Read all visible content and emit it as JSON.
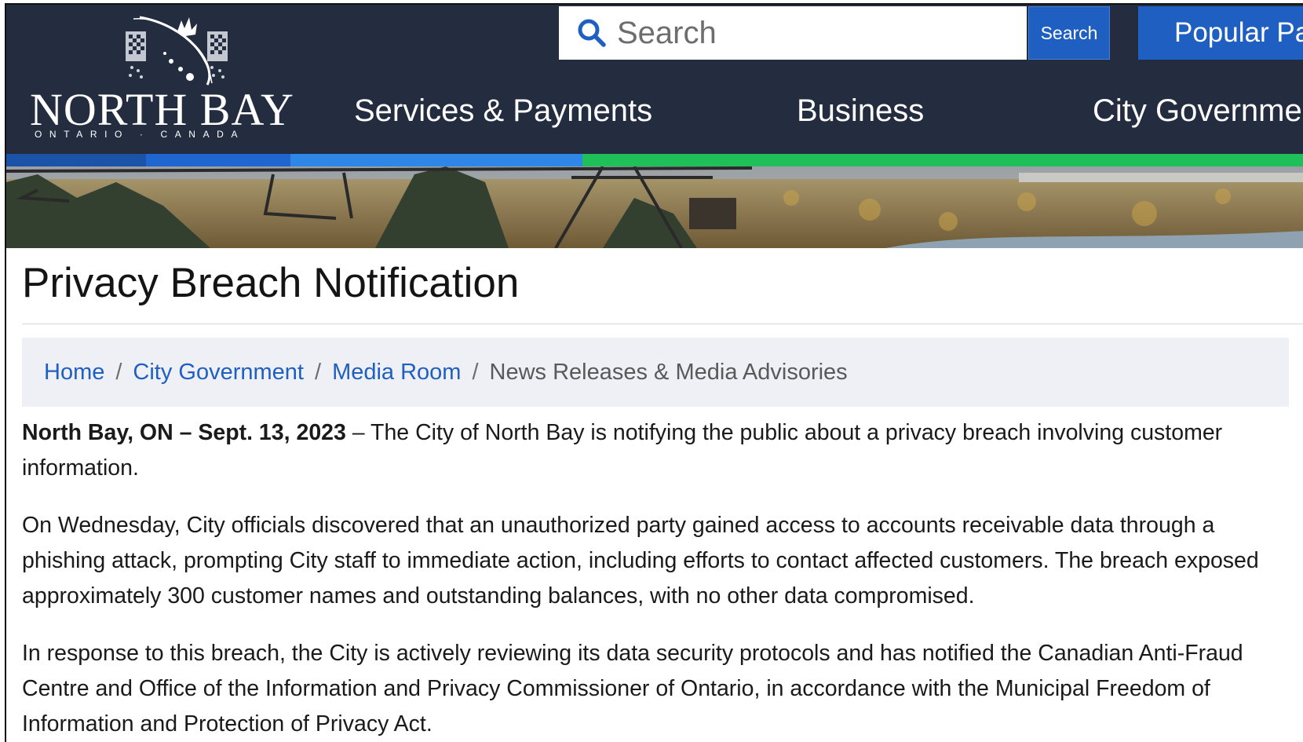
{
  "header": {
    "logo": {
      "wordmark": "NORTH BAY",
      "tagline": "ONTARIO · CANADA"
    },
    "search": {
      "placeholder": "Search",
      "button_label": "Search"
    },
    "popular_pages_label": "Popular Pages",
    "nav": [
      {
        "label": "Services & Payments"
      },
      {
        "label": "Business"
      },
      {
        "label": "City Government"
      }
    ],
    "strip_colors": [
      "#1a53a8",
      "#1f66d1",
      "#2e86e6",
      "#1fbf5a"
    ]
  },
  "page": {
    "title": "Privacy Breach Notification",
    "breadcrumb": [
      {
        "label": "Home"
      },
      {
        "label": "City Government"
      },
      {
        "label": "Media Room"
      },
      {
        "label": "News Releases & Media Advisories"
      }
    ],
    "separator": "/",
    "dateline": "North Bay, ON – Sept. 13, 2023",
    "paragraphs": [
      " – The City of North Bay is notifying the public about a privacy breach involving customer information.",
      "On Wednesday, City officials discovered that an unauthorized party gained access to accounts receivable data through a phishing attack, prompting City staff to immediate action, including efforts to contact affected customers. The breach exposed approximately 300 customer names and outstanding balances, with no other data compromised.",
      "In response to this breach, the City is actively reviewing its data security protocols and has notified the Canadian Anti-Fraud Centre and Office of the Information and Privacy Commissioner of Ontario, in accordance with the Municipal Freedom of Information and Protection of Privacy Act."
    ]
  },
  "colors": {
    "header_bg": "#232d3f",
    "accent_blue": "#1f5fc2",
    "breadcrumb_bg": "#eef0f5"
  }
}
